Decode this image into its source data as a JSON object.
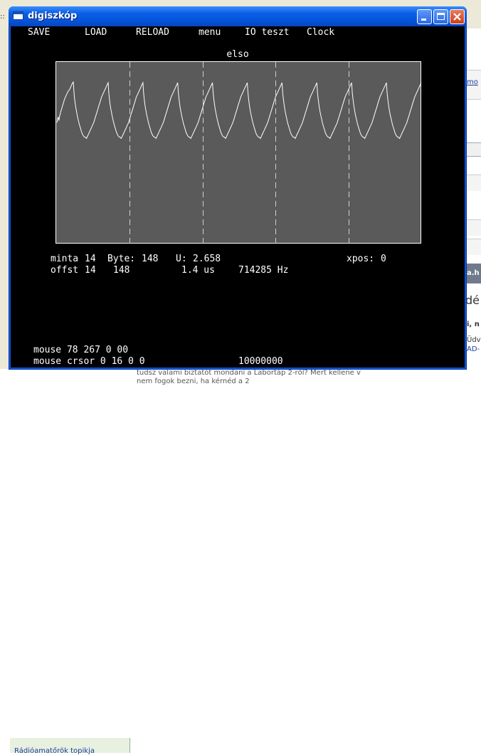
{
  "window": {
    "title": "digiszkóp"
  },
  "menu": {
    "items": [
      {
        "label": "SAVE"
      },
      {
        "label": "LOAD"
      },
      {
        "label": "RELOAD"
      },
      {
        "label": "menu"
      },
      {
        "label": "IO teszt"
      },
      {
        "label": "Clock"
      }
    ]
  },
  "plot": {
    "title": "elso"
  },
  "readouts": {
    "minta_label": "minta",
    "minta_value": "14",
    "byte_label": "Byte:",
    "byte_value": "148",
    "u_label": "U:",
    "u_value": "2.658",
    "xpos_label": "xpos:",
    "xpos_value": "0",
    "offst_label": "offst",
    "offst_value": "14",
    "offst_byte": "148",
    "time_value": "1.4 us",
    "freq_value": "714285 Hz",
    "mouse_line": "mouse 78 267 0 00",
    "crsor_line": "mouse crsor 0 16 0 0",
    "clock_value": "10000000"
  },
  "background": {
    "bottom_text": "tudsz valami biztatót mondani a Labortáp 2-ről? Mert kellene v",
    "bottom_text2": "nem fogok bezni, ha kérnéd a 2",
    "sidebar_text": "Rádióamatőrök topikja",
    "right_text_1": "mo",
    "right_text_2": "a.h",
    "right_text_3": "dé",
    "right_text_4": "i, n",
    "right_text_5": "Üdv",
    "right_text_6": "AD-"
  },
  "colors": {
    "trace": "#ffffff",
    "plot_bg": "#5a5a5a",
    "grid": "#d0d0d0"
  },
  "chart_data": {
    "type": "line",
    "title": "elso",
    "grid_vertical_divisions": 5,
    "series": [
      {
        "values": [
          170,
          175,
          178,
          173,
          179,
          182,
          186,
          189,
          192,
          195,
          198,
          201,
          204,
          206,
          208,
          210,
          212,
          214,
          215,
          216,
          218,
          220,
          222,
          224,
          226,
          227,
          212,
          203,
          196,
          190,
          185,
          180,
          176,
          172,
          168,
          165,
          162,
          159,
          156,
          154,
          152,
          151,
          150,
          150,
          149,
          148,
          150,
          152,
          154,
          156,
          158,
          160,
          162,
          164,
          166,
          168,
          170,
          173,
          176,
          179,
          182,
          185,
          188,
          191,
          194,
          197,
          200,
          203,
          206,
          208,
          210,
          212,
          214,
          216,
          218,
          220,
          222,
          224,
          226,
          212,
          203,
          196,
          190,
          185,
          180,
          176,
          172,
          168,
          165,
          162,
          159,
          156,
          154,
          152,
          151,
          150,
          150,
          149,
          148,
          150,
          152,
          154,
          156,
          158,
          160,
          162,
          164,
          166,
          168,
          170,
          173,
          176,
          179,
          182,
          185,
          188,
          191,
          194,
          197,
          200,
          203,
          206,
          208,
          210,
          212,
          214,
          216,
          218,
          220,
          222,
          224,
          226,
          212,
          203,
          196,
          190,
          185,
          180,
          176,
          172,
          168,
          165,
          162,
          159,
          156,
          154,
          152,
          151,
          150,
          150,
          149,
          148,
          150,
          152,
          154,
          156,
          158,
          160,
          162,
          164,
          166,
          168,
          170,
          173,
          176,
          179,
          182,
          185,
          188,
          191,
          194,
          197,
          200,
          203,
          206,
          208,
          210,
          212,
          214,
          216,
          218,
          220,
          222,
          224,
          226,
          212,
          203,
          196,
          190,
          185,
          180,
          176,
          172,
          168,
          165,
          162,
          159,
          156,
          154,
          152,
          151,
          150,
          150,
          149,
          148,
          150,
          152,
          154,
          156,
          158,
          160,
          162,
          164,
          166,
          168,
          170,
          173,
          176,
          179,
          182,
          185,
          188,
          191,
          194,
          197,
          200,
          203,
          206,
          208,
          210,
          212,
          214,
          216,
          218,
          220,
          222,
          224,
          226,
          212,
          203,
          196,
          190,
          185,
          180,
          176,
          172,
          168,
          165,
          162,
          159,
          156,
          154,
          152,
          151,
          150,
          150,
          149,
          148,
          150,
          152,
          154,
          156,
          158,
          160,
          162,
          164,
          166,
          168,
          170,
          173,
          176,
          179,
          182,
          185,
          188,
          191,
          194,
          197,
          200,
          203,
          206,
          208,
          210,
          212,
          214,
          216,
          218,
          220,
          222,
          224,
          226,
          212,
          203,
          196,
          190,
          185,
          180,
          176,
          172,
          168,
          165,
          162,
          159,
          156,
          154,
          152,
          151,
          150,
          150,
          149,
          148,
          150,
          152,
          154,
          156,
          158,
          160,
          162,
          164,
          166,
          168,
          170,
          173,
          176,
          179,
          182,
          185,
          188,
          191,
          194,
          197,
          200,
          203,
          206,
          208,
          210,
          212,
          214,
          216,
          218,
          220,
          222,
          224,
          226,
          212,
          203,
          196,
          190,
          185,
          180,
          176,
          172,
          168,
          165,
          162,
          159,
          156,
          154,
          152,
          151,
          150,
          150,
          149,
          148,
          150,
          152,
          154,
          156,
          158,
          160,
          162,
          164,
          166,
          168,
          170,
          173,
          176,
          179,
          182,
          185,
          188,
          191,
          194,
          197,
          200,
          203,
          206,
          208,
          210,
          212,
          214,
          216,
          218,
          220,
          222,
          224,
          226,
          212,
          203,
          196,
          190,
          185,
          180,
          176,
          172,
          168,
          165,
          162,
          159,
          156,
          154,
          152,
          151,
          150,
          150,
          149,
          148,
          150,
          152,
          154,
          156,
          158,
          160,
          162,
          164,
          166,
          168,
          170,
          173,
          176,
          179,
          182,
          185,
          188,
          191,
          194,
          197,
          200,
          203,
          206,
          208,
          210,
          212,
          214,
          216,
          218,
          220,
          222,
          224,
          226,
          212,
          203,
          196,
          190,
          185,
          180,
          176,
          172,
          168,
          165,
          162,
          159,
          156,
          154,
          152,
          151,
          150,
          150,
          149,
          148,
          150,
          152,
          154,
          156,
          158,
          160,
          162,
          164,
          166,
          168,
          170,
          173,
          176,
          179,
          182,
          185,
          188,
          191,
          194,
          197,
          200,
          203,
          206,
          208,
          210,
          212,
          214,
          216,
          218,
          220,
          222,
          224,
          226,
          212,
          203,
          196,
          190,
          185,
          180,
          176,
          172,
          168,
          165,
          162,
          159,
          156,
          154,
          152,
          151,
          150,
          150,
          149,
          148,
          150,
          152,
          154,
          156,
          158,
          160,
          162,
          164,
          166,
          168,
          170,
          173,
          176,
          179,
          182,
          185,
          188,
          191,
          194,
          197,
          200,
          203,
          206,
          208,
          210,
          212,
          214,
          216,
          218,
          220,
          222,
          224,
          226
        ],
        "ylim": [
          0,
          255
        ]
      }
    ]
  }
}
